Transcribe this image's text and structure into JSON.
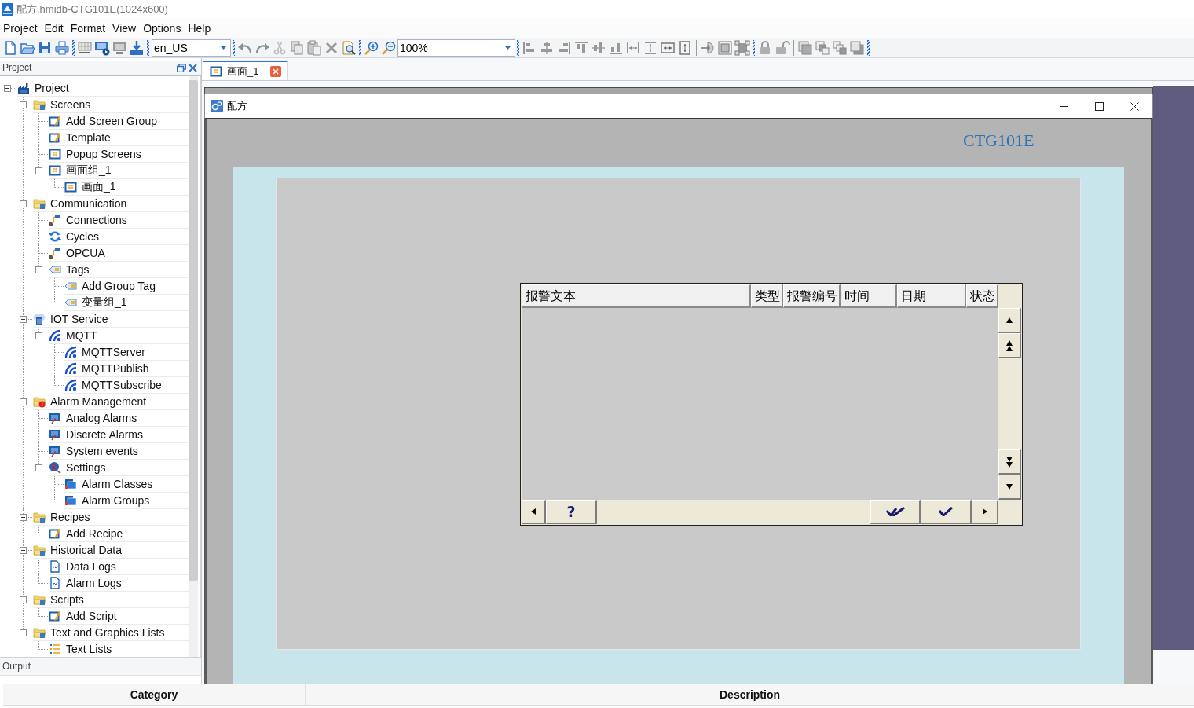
{
  "window": {
    "title": "配方.hmidb-CTG101E(1024x600)"
  },
  "menu": [
    "Project",
    "Edit",
    "Format",
    "View",
    "Options",
    "Help"
  ],
  "toolbar": {
    "language": "en_US",
    "zoom": "100%"
  },
  "project_panel": {
    "title": "Project",
    "tree": [
      {
        "label": "Project",
        "kind": "project",
        "expanded": true,
        "children": [
          {
            "label": "Screens",
            "kind": "folder",
            "expanded": true,
            "children": [
              {
                "label": "Add Screen Group",
                "kind": "edit"
              },
              {
                "label": "Template",
                "kind": "edit"
              },
              {
                "label": "Popup Screens",
                "kind": "screen"
              },
              {
                "label": "画面组_1",
                "kind": "screen",
                "expanded": true,
                "children": [
                  {
                    "label": "画面_1",
                    "kind": "screen"
                  }
                ]
              }
            ]
          },
          {
            "label": "Communication",
            "kind": "folder",
            "expanded": true,
            "children": [
              {
                "label": "Connections",
                "kind": "link"
              },
              {
                "label": "Cycles",
                "kind": "cycle"
              },
              {
                "label": "OPCUA",
                "kind": "link"
              },
              {
                "label": "Tags",
                "kind": "tag",
                "expanded": true,
                "children": [
                  {
                    "label": "Add Group Tag",
                    "kind": "tag"
                  },
                  {
                    "label": "变量组_1",
                    "kind": "tag"
                  }
                ]
              }
            ]
          },
          {
            "label": "IOT Service",
            "kind": "server",
            "expanded": true,
            "children": [
              {
                "label": "MQTT",
                "kind": "signal",
                "expanded": true,
                "children": [
                  {
                    "label": "MQTTServer",
                    "kind": "signal"
                  },
                  {
                    "label": "MQTTPublish",
                    "kind": "signal"
                  },
                  {
                    "label": "MQTTSubscribe",
                    "kind": "signal"
                  }
                ]
              }
            ]
          },
          {
            "label": "Alarm Management",
            "kind": "alarm_folder",
            "expanded": true,
            "children": [
              {
                "label": "Analog Alarms",
                "kind": "monitor"
              },
              {
                "label": "Discrete Alarms",
                "kind": "monitor"
              },
              {
                "label": "System events",
                "kind": "monitor"
              },
              {
                "label": "Settings",
                "kind": "alert",
                "expanded": true,
                "children": [
                  {
                    "label": "Alarm Classes",
                    "kind": "windows"
                  },
                  {
                    "label": "Alarm Groups",
                    "kind": "windows"
                  }
                ]
              }
            ]
          },
          {
            "label": "Recipes",
            "kind": "folder",
            "expanded": true,
            "children": [
              {
                "label": "Add Recipe",
                "kind": "edit"
              }
            ]
          },
          {
            "label": "Historical Data",
            "kind": "folder",
            "expanded": true,
            "children": [
              {
                "label": "Data Logs",
                "kind": "document"
              },
              {
                "label": "Alarm Logs",
                "kind": "document"
              }
            ]
          },
          {
            "label": "Scripts",
            "kind": "folder",
            "expanded": true,
            "children": [
              {
                "label": "Add Script",
                "kind": "edit"
              }
            ]
          },
          {
            "label": "Text and Graphics Lists",
            "kind": "folder",
            "expanded": true,
            "children": [
              {
                "label": "Text Lists",
                "kind": "list"
              }
            ]
          }
        ]
      }
    ]
  },
  "tabs": [
    {
      "label": "画面_1",
      "selected": true
    }
  ],
  "screen_window": {
    "title": "配方",
    "device_label": "CTG101E",
    "alarm_view": {
      "columns": [
        "报警文本",
        "类型",
        "报警编号",
        "时间",
        "日期",
        "状态"
      ],
      "help_button": "?"
    }
  },
  "output_panel": {
    "title": "Output",
    "columns": [
      "Category",
      "Description"
    ]
  }
}
